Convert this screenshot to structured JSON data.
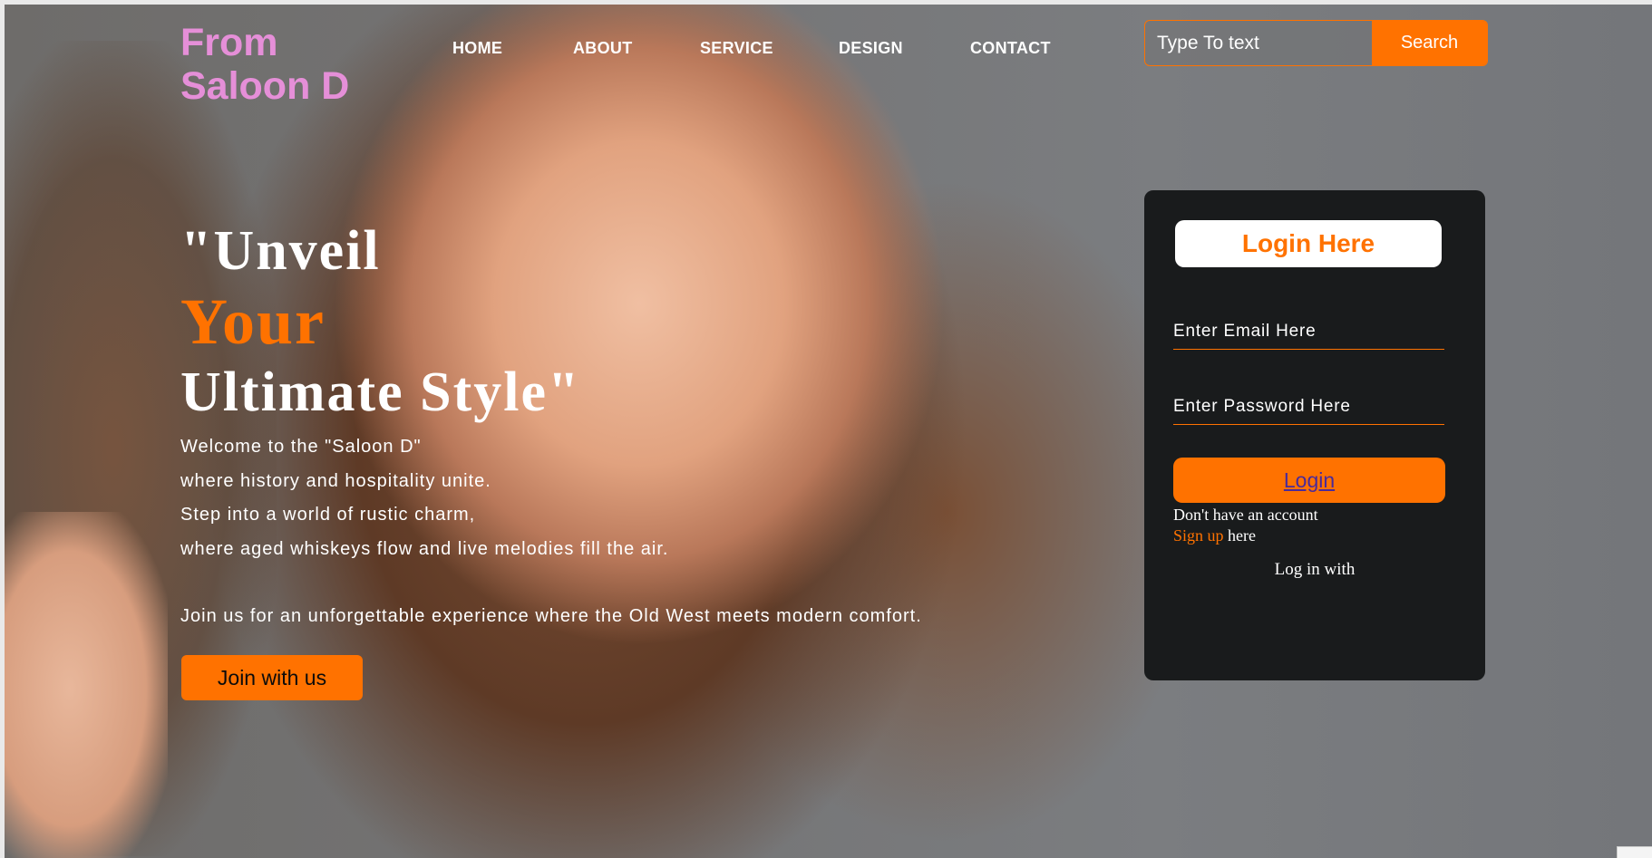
{
  "brand": {
    "line1": "From",
    "line2": "Saloon D"
  },
  "nav": {
    "items": [
      {
        "label": "HOME"
      },
      {
        "label": "ABOUT"
      },
      {
        "label": "SERVICE"
      },
      {
        "label": "DESIGN"
      },
      {
        "label": "CONTACT"
      }
    ]
  },
  "search": {
    "placeholder": "Type To text",
    "button_label": "Search"
  },
  "hero": {
    "line1": "\"Unveil",
    "line2": "Your",
    "line3": "Ultimate Style\"",
    "paragraph": [
      "Welcome to the \"Saloon D\"",
      "where history and hospitality unite.",
      "Step into a world of rustic charm,",
      "where aged whiskeys flow and live melodies fill the air."
    ],
    "closing": "Join us for an unforgettable experience where the Old West meets modern comfort.",
    "cta_label": "Join with us"
  },
  "login": {
    "title": "Login Here",
    "email_placeholder": "Enter Email Here",
    "password_placeholder": "Enter Password Here",
    "button_label": "Login",
    "no_account": "Don't have an account",
    "signup_link": "Sign up",
    "signup_suffix": " here",
    "login_with": "Log in with"
  },
  "colors": {
    "accent": "#ff7200",
    "brand_pink": "#e58fd8",
    "card_bg": "#191b1c"
  }
}
